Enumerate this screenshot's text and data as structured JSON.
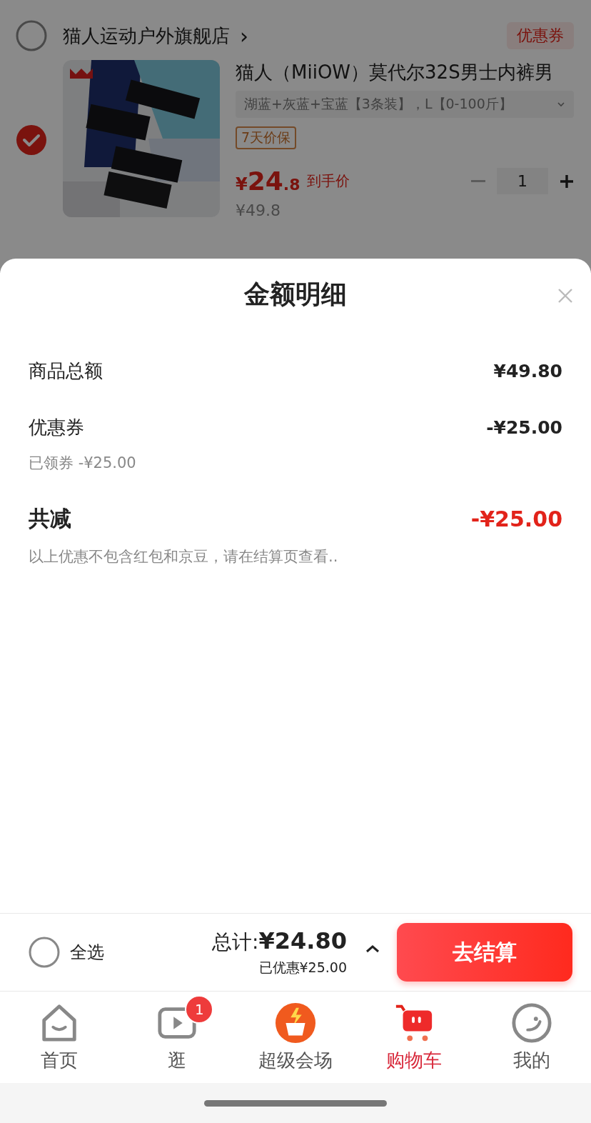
{
  "cart": {
    "store": {
      "name": "猫人运动户外旗舰店",
      "chevron": "›",
      "selected": false
    },
    "coupon_tag": "优惠券",
    "item": {
      "selected": true,
      "title": "猫人（MiiOW）莫代尔32S男士内裤男",
      "variant": "湖蓝+灰蓝+宝蓝【3条装】，L【0-100斤】",
      "guarantee": "7天价保",
      "price_currency": "¥",
      "price_int": "24",
      "price_dec": ".8",
      "price_note": "到手价",
      "original_price": "¥49.8",
      "quantity": "1",
      "minus_disabled": true
    }
  },
  "sheet": {
    "title": "金额明细",
    "rows": [
      {
        "kind": "line",
        "label": "商品总额",
        "value": "¥49.80"
      },
      {
        "kind": "line",
        "label": "优惠券",
        "value": "-¥25.00",
        "note": "已领券 -¥25.00"
      },
      {
        "kind": "total",
        "label": "共减",
        "value": "-¥25.00",
        "note": "以上优惠不包含红包和京豆，请在结算页查看.."
      }
    ]
  },
  "checkout_bar": {
    "select_all": {
      "label": "全选",
      "checked": false
    },
    "total_label": "总计:",
    "total": "¥24.80",
    "saved": "已优惠¥25.00",
    "button": "去结算"
  },
  "tabs": [
    {
      "label": "首页",
      "selected": false
    },
    {
      "label": "逛",
      "selected": false,
      "badge": "1"
    },
    {
      "label": "超级会场",
      "selected": false
    },
    {
      "label": "购物车",
      "selected": true
    },
    {
      "label": "我的",
      "selected": false
    }
  ]
}
